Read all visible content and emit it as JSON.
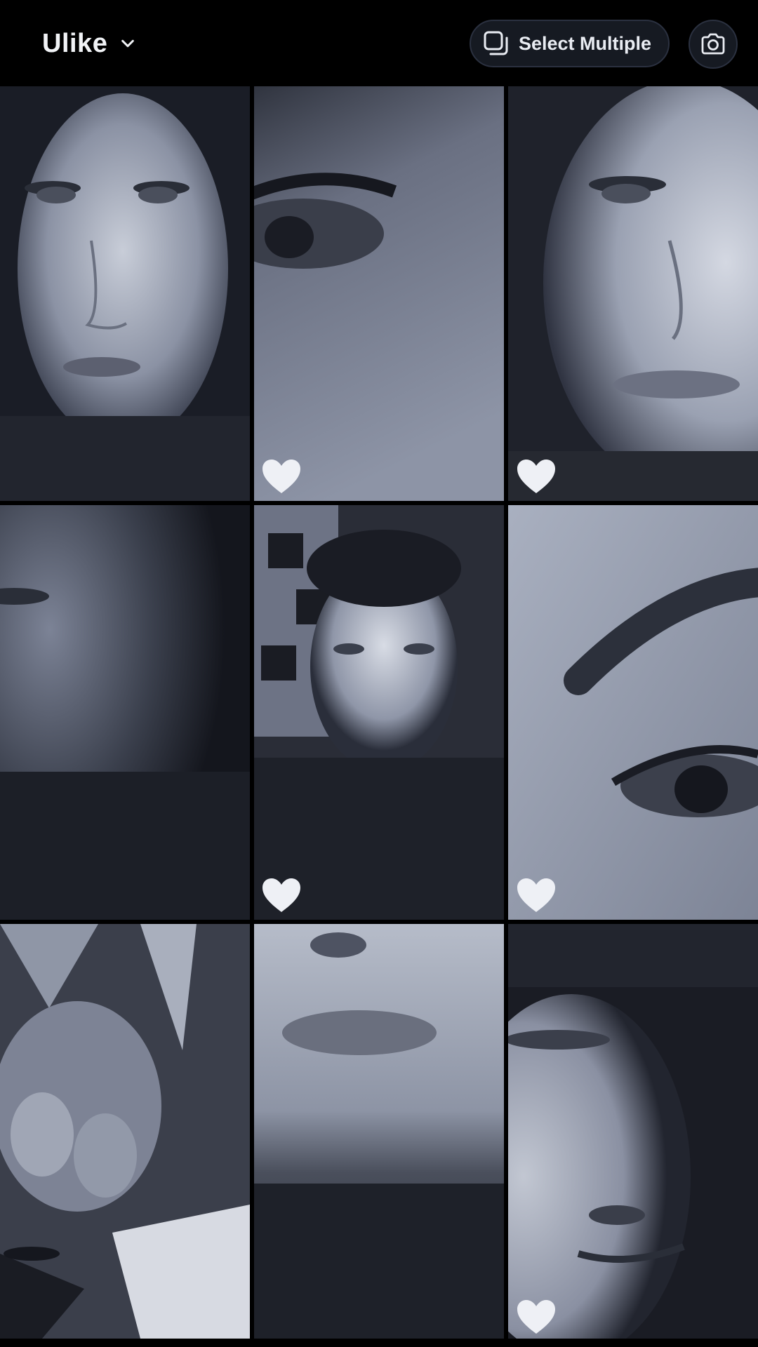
{
  "header": {
    "album_title": "Ulike",
    "album_chevron_icon": "chevron-down-icon",
    "select_multiple_label": "Select Multiple",
    "select_multiple_icon": "stacked-squares-icon",
    "camera_icon": "camera-icon"
  },
  "colors": {
    "background": "#000000",
    "text": "#f1f3f6",
    "pill_background": "#161a22",
    "pill_border": "#2b3140",
    "photo_tint": "#8d96ad",
    "heart": "#eef0f5"
  },
  "grid": {
    "columns": 3,
    "photos": [
      {
        "subject": "face-portrait",
        "favorite": false
      },
      {
        "subject": "eye-closeup",
        "favorite": true
      },
      {
        "subject": "face-half-crop",
        "favorite": true
      },
      {
        "subject": "dark-cheek-closeup",
        "favorite": false
      },
      {
        "subject": "face-portrait-with-blanket",
        "favorite": true
      },
      {
        "subject": "eyebrow-eye-closeup",
        "favorite": true
      },
      {
        "subject": "hand-on-blanket",
        "favorite": false
      },
      {
        "subject": "lips-chin-closeup",
        "favorite": false
      },
      {
        "subject": "face-upside-down",
        "favorite": true
      }
    ]
  }
}
